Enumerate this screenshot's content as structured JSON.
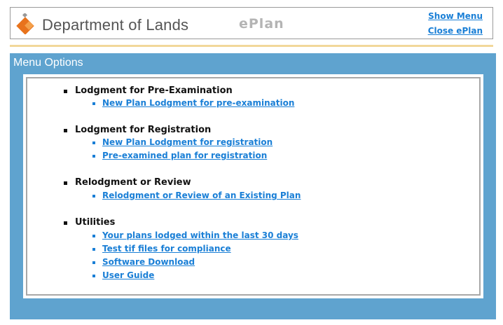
{
  "header": {
    "org_name": "Department of Lands",
    "app_name": "ePlan",
    "show_menu": "Show Menu",
    "close_eplan": "Close ePlan"
  },
  "panel": {
    "title": "Menu Options"
  },
  "sections": [
    {
      "title": "Lodgment for Pre-Examination",
      "links": [
        "New Plan Lodgment for pre-examination"
      ]
    },
    {
      "title": "Lodgment for Registration",
      "links": [
        "New Plan Lodgment for registration",
        "Pre-examined plan for registration"
      ]
    },
    {
      "title": "Relodgment or Review",
      "links": [
        "Relodgment or Review of an Existing Plan"
      ]
    },
    {
      "title": "Utilities",
      "links": [
        "Your plans lodged within the last 30 days",
        "Test tif files for compliance",
        "Software Download",
        "User Guide"
      ]
    }
  ],
  "colors": {
    "panel_bg": "#5fa3cf",
    "link": "#1a7fd6",
    "separator": "#f2d89a",
    "logo_orange": "#e8731c"
  }
}
